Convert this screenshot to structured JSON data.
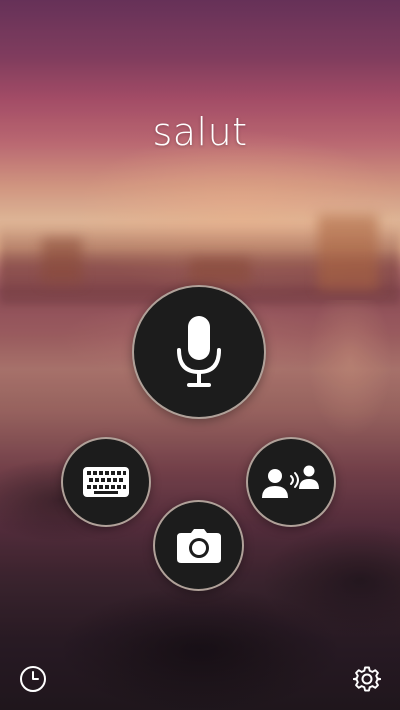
{
  "greeting": {
    "text": "salut"
  },
  "actions": {
    "speak": {
      "icon": "microphone-icon"
    },
    "type": {
      "icon": "keyboard-icon"
    },
    "conversation": {
      "icon": "conversation-icon"
    },
    "camera": {
      "icon": "camera-icon"
    }
  },
  "footer": {
    "history": {
      "icon": "clock-icon"
    },
    "settings": {
      "icon": "gear-icon"
    }
  },
  "colors": {
    "button_fill": "#1c1c1c",
    "button_ring": "#e1cdc3",
    "icon": "#ffffff"
  }
}
